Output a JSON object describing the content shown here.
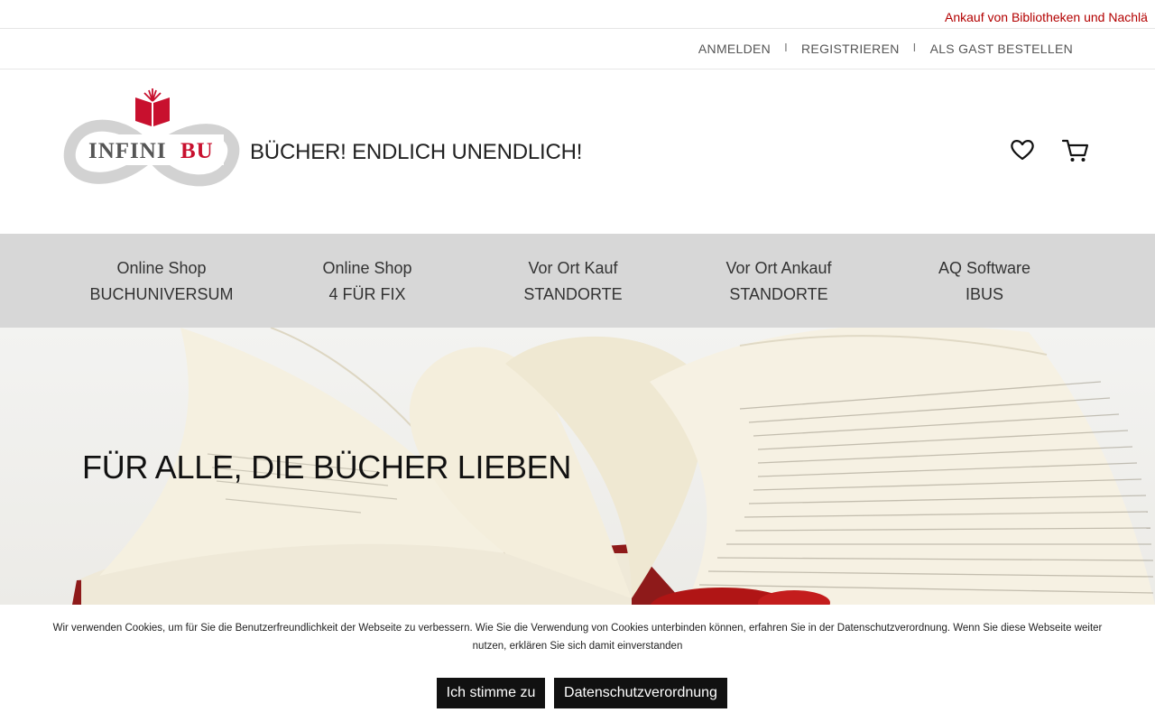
{
  "ticker": {
    "text": "Ankauf von Bibliotheken und Nachlä"
  },
  "account": {
    "login": "ANMELDEN",
    "register": "REGISTRIEREN",
    "guest": "ALS GAST BESTELLEN",
    "separator": "I"
  },
  "header": {
    "logo_left": "INFINI",
    "logo_right": "BU",
    "tagline": "BÜCHER! ENDLICH UNENDLICH!",
    "wishlist_icon": "heart-icon",
    "cart_icon": "cart-icon"
  },
  "nav": {
    "items": [
      {
        "line1": "Online Shop",
        "line2": "BUCHUNIVERSUM"
      },
      {
        "line1": "Online Shop",
        "line2": "4 FÜR FIX"
      },
      {
        "line1": "Vor Ort Kauf",
        "line2": "STANDORTE"
      },
      {
        "line1": "Vor Ort Ankauf",
        "line2": "STANDORTE"
      },
      {
        "line1": "AQ Software",
        "line2": "IBUS"
      }
    ]
  },
  "hero": {
    "title": "FÜR ALLE, DIE BÜCHER LIEBEN"
  },
  "cookie": {
    "text": "Wir verwenden Cookies, um für Sie die Benutzerfreundlichkeit der Webseite zu verbessern. Wie Sie die Verwendung von Cookies unterbinden können, erfahren Sie in der Datenschutzverordnung. Wenn Sie diese Webseite weiter nutzen, erklären Sie sich damit einverstanden",
    "agree_label": "Ich stimme zu",
    "privacy_label": "Datenschutzverordnung"
  },
  "colors": {
    "brand_red": "#c8102e",
    "nav_bg": "#d7d7d7",
    "button_bg": "#111111"
  }
}
